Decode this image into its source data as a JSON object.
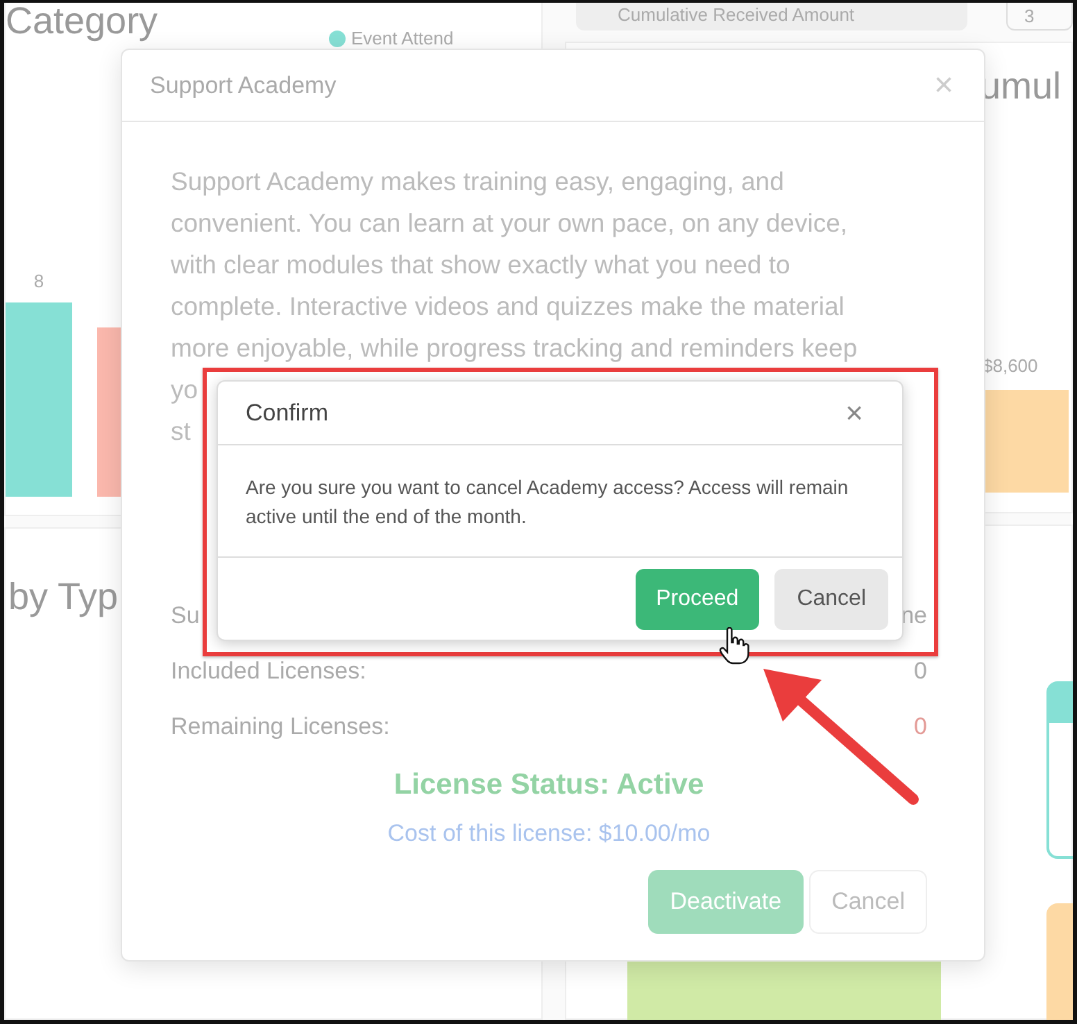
{
  "background": {
    "left_panels": [
      {
        "heading": "Category",
        "legend": [
          {
            "label": "Event Attend",
            "color": "#86e0d5"
          }
        ],
        "bar_label": "8"
      },
      {
        "heading": "by Typ"
      }
    ],
    "right_panels": [
      {
        "dropdown": "Cumulative Received Amount",
        "dropdown_2": "3",
        "heading": "umul",
        "bar_label": "$8,600"
      }
    ]
  },
  "modal": {
    "title": "Support Academy",
    "close": "×",
    "description_lines": [
      "Support Academy makes training easy, engaging, and",
      "convenient. You can learn at your own pace, on any device,",
      "with clear modules that show exactly what you need to",
      "complete. Interactive videos and quizzes make the material",
      "more enjoyable, while progress tracking and reminders keep"
    ],
    "description_fragments": [
      "yo",
      "st"
    ],
    "rows": [
      {
        "label": "Su",
        "value": "ne",
        "kind": "plain"
      },
      {
        "label": "Included Licenses:",
        "value": "0",
        "kind": "plain"
      },
      {
        "label": "Remaining Licenses:",
        "value": "0",
        "kind": "warning"
      }
    ],
    "status": "License Status: Active",
    "cost": "Cost of this license: $10.00/mo",
    "buttons": [
      {
        "label": "Deactivate",
        "kind": "primary"
      },
      {
        "label": "Cancel",
        "kind": "secondary"
      }
    ]
  },
  "confirm": {
    "title": "Confirm",
    "close": "×",
    "message": "Are you sure you want to cancel Academy access? Access will remain active until the end of the month.",
    "buttons": [
      {
        "label": "Proceed",
        "kind": "primary"
      },
      {
        "label": "Cancel",
        "kind": "secondary"
      }
    ]
  }
}
